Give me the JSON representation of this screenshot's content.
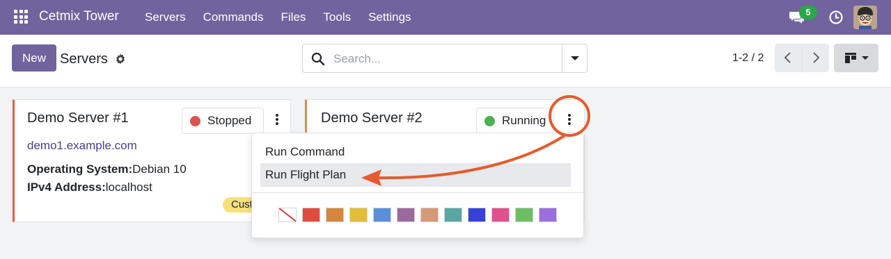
{
  "navbar": {
    "brand": "Cetmix Tower",
    "menu": [
      "Servers",
      "Commands",
      "Files",
      "Tools",
      "Settings"
    ],
    "notification_count": "5"
  },
  "control_panel": {
    "new_label": "New",
    "title": "Servers",
    "search": {
      "placeholder": "Search..."
    },
    "pager": "1-2 / 2"
  },
  "cards": [
    {
      "title": "Demo Server #1",
      "status": "Stopped",
      "status_color": "#d9534f",
      "link": "demo1.example.com",
      "fields": [
        {
          "label": "Operating System:",
          "value": "Debian 10"
        },
        {
          "label": "IPv4 Address:",
          "value": "localhost"
        }
      ],
      "tag": "Custom"
    },
    {
      "title": "Demo Server #2",
      "status": "Running",
      "status_color": "#4caf50"
    }
  ],
  "dropdown": {
    "items": [
      "Run Command",
      "Run Flight Plan"
    ],
    "active_index": 1,
    "colors": [
      "none",
      "#e04b3c",
      "#d4873d",
      "#e3bd3a",
      "#5b8fda",
      "#9b6a9c",
      "#d69a78",
      "#5ba5a3",
      "#3642d6",
      "#e0508d",
      "#6dbd63",
      "#9b6fe0"
    ]
  },
  "colors": {
    "primary": "#71639e",
    "annotation": "#e65a2e"
  }
}
